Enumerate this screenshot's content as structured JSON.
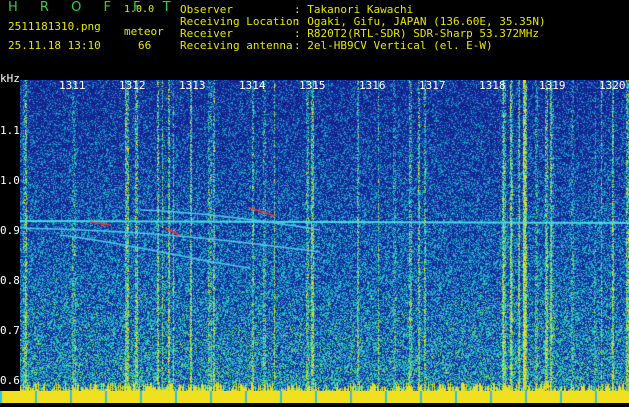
{
  "header": {
    "title": "H R O F F T",
    "version": "1.0.0",
    "filename": "2511181310.png",
    "datetime": "25.11.18 13:10",
    "mode": "meteor",
    "count": "66",
    "labels": [
      "Observer",
      "Receiving Location",
      "Receiver",
      "Receiving antenna"
    ],
    "values": [
      ": Takanori Kawachi",
      ": Ogaki, Gifu, JAPAN (136.60E, 35.35N)",
      ": R820T2(RTL-SDR) SDR-Sharp 53.372MHz",
      ": 2el-HB9CV Vertical (el. E-W)"
    ]
  },
  "axis": {
    "unit": "kHz",
    "time_ticks": [
      "1311",
      "1312",
      "1313",
      "1314",
      "1315",
      "1316",
      "1317",
      "1318",
      "1319",
      "1320"
    ],
    "freq_ticks": [
      "1.1",
      "1.0",
      "0.9",
      "0.8",
      "0.7",
      "0.6"
    ]
  },
  "colors": {
    "background": "#000000",
    "text_yellow": "#e9e600",
    "title_green": "#2fd23a",
    "spectrum_low": "#1c1a8c",
    "spectrum_mid": "#2fb8d8",
    "spectrum_high": "#f0e020",
    "spectrum_peak": "#ff2020"
  }
}
